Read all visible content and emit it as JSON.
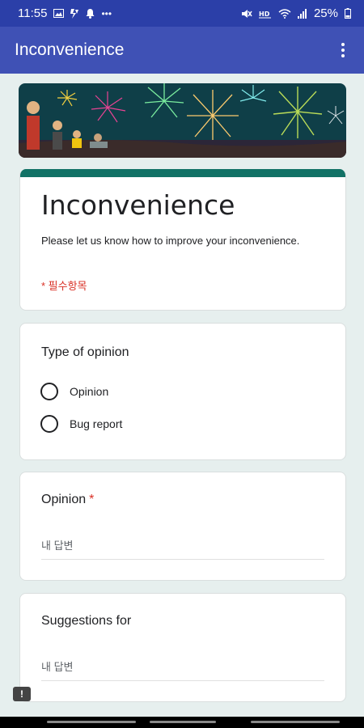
{
  "status_bar": {
    "time": "11:55",
    "left_icons": [
      "image-icon",
      "flash-icon",
      "notification-icon",
      "more-icon"
    ],
    "right_icons": [
      "mute-icon",
      "hd-icon",
      "wifi-icon",
      "signal-icon"
    ],
    "battery": "25%"
  },
  "app_bar": {
    "title": "Inconvenience"
  },
  "form": {
    "title": "Inconvenience",
    "description": "Please let us know how to improve your inconvenience.",
    "required_note": "* 필수항목"
  },
  "questions": {
    "type": {
      "title": "Type of opinion",
      "options": [
        "Opinion",
        "Bug report"
      ]
    },
    "opinion": {
      "title": "Opinion",
      "required": "*",
      "placeholder": "내 답변"
    },
    "suggestions": {
      "title": "Suggestions for",
      "placeholder": "내 답변"
    }
  },
  "feedback_icon": "!",
  "colors": {
    "status_bar": "#2b3fa8",
    "app_bar": "#3f51b5",
    "accent": "#127266",
    "required": "#d93025",
    "background": "#e6efee"
  }
}
